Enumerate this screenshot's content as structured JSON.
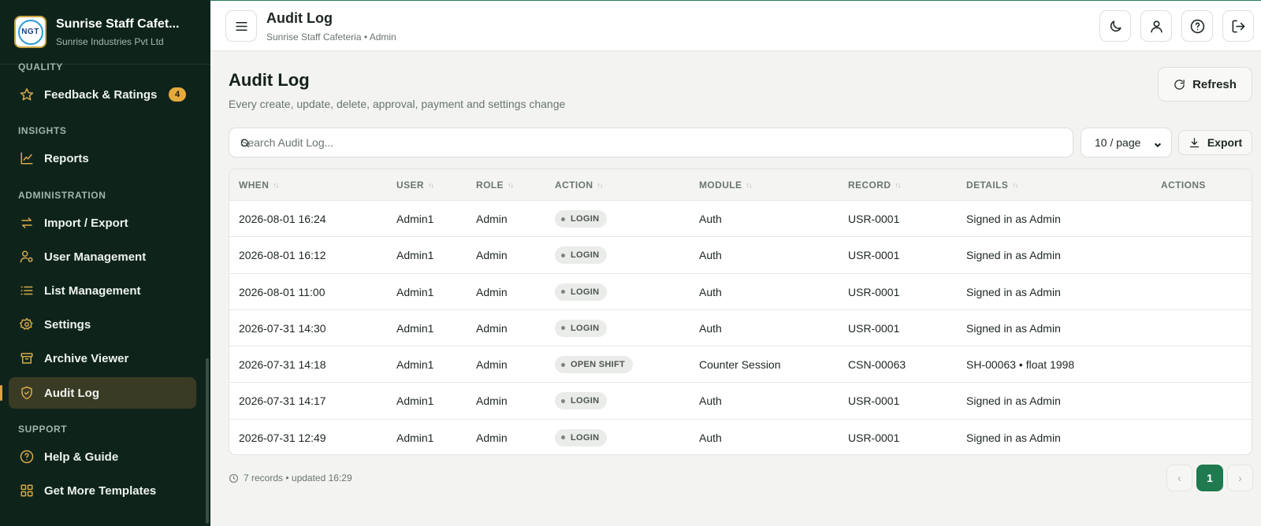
{
  "sidebar": {
    "brand_name": "Sunrise Staff Cafet...",
    "brand_sub": "Sunrise Industries Pvt Ltd",
    "logo_text": "NGT",
    "sections": {
      "quality": "QUALITY",
      "insights": "INSIGHTS",
      "administration": "ADMINISTRATION",
      "support": "SUPPORT"
    },
    "items": [
      {
        "label": "Feedback & Ratings",
        "icon": "star-icon",
        "badge": "4"
      },
      {
        "label": "Reports",
        "icon": "chart-line-icon"
      },
      {
        "label": "Import / Export",
        "icon": "arrows-swap-icon"
      },
      {
        "label": "User Management",
        "icon": "user-cog-icon"
      },
      {
        "label": "List Management",
        "icon": "list-icon"
      },
      {
        "label": "Settings",
        "icon": "gear-icon"
      },
      {
        "label": "Archive Viewer",
        "icon": "archive-icon"
      },
      {
        "label": "Audit Log",
        "icon": "shield-check-icon",
        "active": true
      },
      {
        "label": "Help & Guide",
        "icon": "help-circle-icon"
      },
      {
        "label": "Get More Templates",
        "icon": "grid-icon"
      }
    ]
  },
  "topbar": {
    "title": "Audit Log",
    "subtitle": "Sunrise Staff Cafeteria • Admin"
  },
  "page": {
    "title": "Audit Log",
    "subtitle": "Every create, update, delete, approval, payment and settings change",
    "refresh_label": "Refresh",
    "search_placeholder": "Search Audit Log...",
    "per_page": "10 / page",
    "export_label": "Export"
  },
  "table": {
    "columns": [
      "WHEN",
      "USER",
      "ROLE",
      "ACTION",
      "MODULE",
      "RECORD",
      "DETAILS",
      "ACTIONS"
    ],
    "rows": [
      {
        "when": "2026-08-01 16:24",
        "user": "Admin1",
        "role": "Admin",
        "action": "LOGIN",
        "module": "Auth",
        "record": "USR-0001",
        "details": "Signed in as Admin"
      },
      {
        "when": "2026-08-01 16:12",
        "user": "Admin1",
        "role": "Admin",
        "action": "LOGIN",
        "module": "Auth",
        "record": "USR-0001",
        "details": "Signed in as Admin"
      },
      {
        "when": "2026-08-01 11:00",
        "user": "Admin1",
        "role": "Admin",
        "action": "LOGIN",
        "module": "Auth",
        "record": "USR-0001",
        "details": "Signed in as Admin"
      },
      {
        "when": "2026-07-31 14:30",
        "user": "Admin1",
        "role": "Admin",
        "action": "LOGIN",
        "module": "Auth",
        "record": "USR-0001",
        "details": "Signed in as Admin"
      },
      {
        "when": "2026-07-31 14:18",
        "user": "Admin1",
        "role": "Admin",
        "action": "OPEN SHIFT",
        "module": "Counter Session",
        "record": "CSN-00063",
        "details": "SH-00063 • float 1998"
      },
      {
        "when": "2026-07-31 14:17",
        "user": "Admin1",
        "role": "Admin",
        "action": "LOGIN",
        "module": "Auth",
        "record": "USR-0001",
        "details": "Signed in as Admin"
      },
      {
        "when": "2026-07-31 12:49",
        "user": "Admin1",
        "role": "Admin",
        "action": "LOGIN",
        "module": "Auth",
        "record": "USR-0001",
        "details": "Signed in as Admin"
      }
    ]
  },
  "footer": {
    "info": "7 records • updated 16:29",
    "current_page": "1",
    "prev": "‹",
    "next": "›"
  },
  "colors": {
    "sidebar_bg": "#0e241b",
    "accent": "#d9a441",
    "primary": "#1f7a4f"
  }
}
